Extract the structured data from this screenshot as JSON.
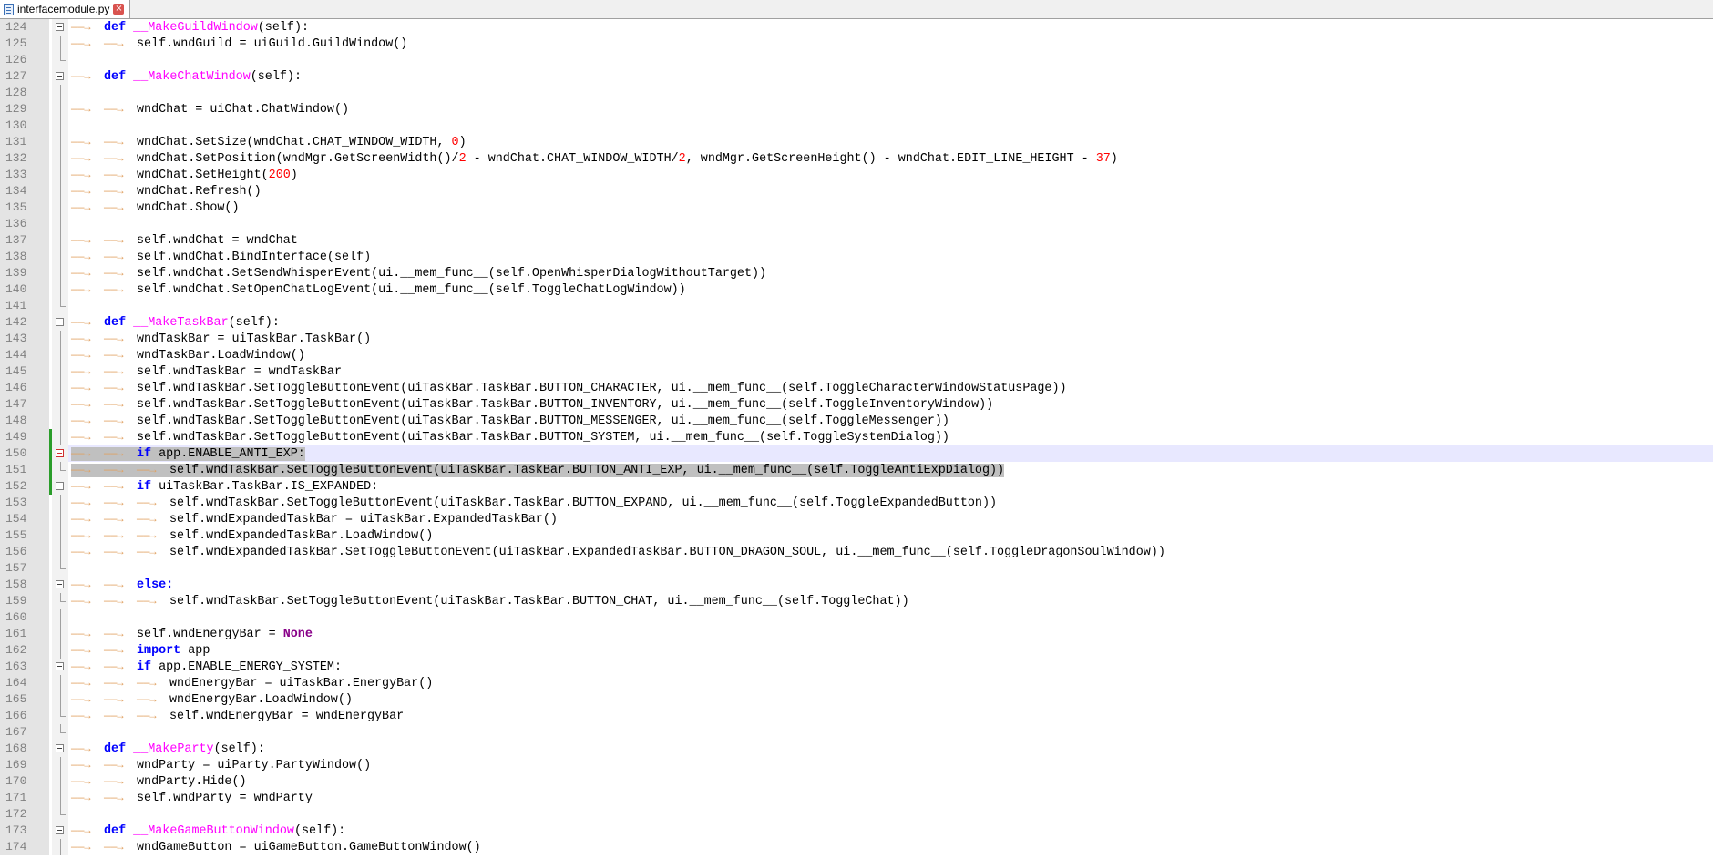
{
  "tab": {
    "filename": "interfacemodule.py",
    "close": "×"
  },
  "lines": [
    {
      "n": "124",
      "ind": 1,
      "fold": "box",
      "segs": [
        {
          "t": "def",
          "c": "kw"
        },
        {
          "t": " "
        },
        {
          "t": "__MakeGuildWindow",
          "c": "fn"
        },
        {
          "t": "(self):"
        }
      ]
    },
    {
      "n": "125",
      "ind": 2,
      "fold": "line",
      "segs": [
        {
          "t": "self.wndGuild = uiGuild.GuildWindow()"
        }
      ]
    },
    {
      "n": "126",
      "ind": 0,
      "fold": "end",
      "segs": []
    },
    {
      "n": "127",
      "ind": 1,
      "fold": "box",
      "segs": [
        {
          "t": "def",
          "c": "kw"
        },
        {
          "t": " "
        },
        {
          "t": "__MakeChatWindow",
          "c": "fn"
        },
        {
          "t": "(self):"
        }
      ]
    },
    {
      "n": "128",
      "ind": 0,
      "fold": "line",
      "segs": []
    },
    {
      "n": "129",
      "ind": 2,
      "fold": "line",
      "segs": [
        {
          "t": "wndChat = uiChat.ChatWindow()"
        }
      ]
    },
    {
      "n": "130",
      "ind": 0,
      "fold": "line",
      "segs": []
    },
    {
      "n": "131",
      "ind": 2,
      "fold": "line",
      "segs": [
        {
          "t": "wndChat.SetSize(wndChat.CHAT_WINDOW_WIDTH, "
        },
        {
          "t": "0",
          "c": "num"
        },
        {
          "t": ")"
        }
      ]
    },
    {
      "n": "132",
      "ind": 2,
      "fold": "line",
      "segs": [
        {
          "t": "wndChat.SetPosition(wndMgr.GetScreenWidth()/"
        },
        {
          "t": "2",
          "c": "num"
        },
        {
          "t": " - wndChat.CHAT_WINDOW_WIDTH/"
        },
        {
          "t": "2",
          "c": "num"
        },
        {
          "t": ", wndMgr.GetScreenHeight() - wndChat.EDIT_LINE_HEIGHT - "
        },
        {
          "t": "37",
          "c": "num"
        },
        {
          "t": ")"
        }
      ]
    },
    {
      "n": "133",
      "ind": 2,
      "fold": "line",
      "segs": [
        {
          "t": "wndChat.SetHeight("
        },
        {
          "t": "200",
          "c": "num"
        },
        {
          "t": ")"
        }
      ]
    },
    {
      "n": "134",
      "ind": 2,
      "fold": "line",
      "segs": [
        {
          "t": "wndChat.Refresh()"
        }
      ]
    },
    {
      "n": "135",
      "ind": 2,
      "fold": "line",
      "segs": [
        {
          "t": "wndChat.Show()"
        }
      ]
    },
    {
      "n": "136",
      "ind": 0,
      "fold": "line",
      "segs": []
    },
    {
      "n": "137",
      "ind": 2,
      "fold": "line",
      "segs": [
        {
          "t": "self.wndChat = wndChat"
        }
      ]
    },
    {
      "n": "138",
      "ind": 2,
      "fold": "line",
      "segs": [
        {
          "t": "self.wndChat.BindInterface(self)"
        }
      ]
    },
    {
      "n": "139",
      "ind": 2,
      "fold": "line",
      "segs": [
        {
          "t": "self.wndChat.SetSendWhisperEvent(ui.__mem_func__(self.OpenWhisperDialogWithoutTarget))"
        }
      ]
    },
    {
      "n": "140",
      "ind": 2,
      "fold": "line",
      "segs": [
        {
          "t": "self.wndChat.SetOpenChatLogEvent(ui.__mem_func__(self.ToggleChatLogWindow))"
        }
      ]
    },
    {
      "n": "141",
      "ind": 0,
      "fold": "end",
      "segs": []
    },
    {
      "n": "142",
      "ind": 1,
      "fold": "box",
      "segs": [
        {
          "t": "def",
          "c": "kw"
        },
        {
          "t": " "
        },
        {
          "t": "__MakeTaskBar",
          "c": "fn"
        },
        {
          "t": "(self):"
        }
      ]
    },
    {
      "n": "143",
      "ind": 2,
      "fold": "line",
      "segs": [
        {
          "t": "wndTaskBar = uiTaskBar.TaskBar()"
        }
      ]
    },
    {
      "n": "144",
      "ind": 2,
      "fold": "line",
      "segs": [
        {
          "t": "wndTaskBar.LoadWindow()"
        }
      ]
    },
    {
      "n": "145",
      "ind": 2,
      "fold": "line",
      "segs": [
        {
          "t": "self.wndTaskBar = wndTaskBar"
        }
      ]
    },
    {
      "n": "146",
      "ind": 2,
      "fold": "line",
      "segs": [
        {
          "t": "self.wndTaskBar.SetToggleButtonEvent(uiTaskBar.TaskBar.BUTTON_CHARACTER, ui.__mem_func__(self.ToggleCharacterWindowStatusPage))"
        }
      ]
    },
    {
      "n": "147",
      "ind": 2,
      "fold": "line",
      "segs": [
        {
          "t": "self.wndTaskBar.SetToggleButtonEvent(uiTaskBar.TaskBar.BUTTON_INVENTORY, ui.__mem_func__(self.ToggleInventoryWindow))"
        }
      ]
    },
    {
      "n": "148",
      "ind": 2,
      "fold": "line",
      "segs": [
        {
          "t": "self.wndTaskBar.SetToggleButtonEvent(uiTaskBar.TaskBar.BUTTON_MESSENGER, ui.__mem_func__(self.ToggleMessenger))"
        }
      ]
    },
    {
      "n": "149",
      "ind": 2,
      "fold": "line",
      "change": true,
      "segs": [
        {
          "t": "self.wndTaskBar.SetToggleButtonEvent(uiTaskBar.TaskBar.BUTTON_SYSTEM, ui.__mem_func__(self.ToggleSystemDialog))"
        }
      ]
    },
    {
      "n": "150",
      "ind": 2,
      "fold": "redbox",
      "change": true,
      "hl": true,
      "sel": true,
      "segs": [
        {
          "t": "if",
          "c": "kw"
        },
        {
          "t": " app.ENABLE_ANTI_EXP:"
        }
      ]
    },
    {
      "n": "151",
      "ind": 3,
      "fold": "end",
      "change": true,
      "sel": true,
      "segs": [
        {
          "t": "self.wndTaskBar.SetToggleButtonEvent(uiTaskBar.TaskBar.BUTTON_ANTI_EXP, ui.__mem_func__(self.ToggleAntiExpDialog))"
        }
      ]
    },
    {
      "n": "152",
      "ind": 2,
      "fold": "box",
      "change": true,
      "segs": [
        {
          "t": "if",
          "c": "kw"
        },
        {
          "t": " uiTaskBar.TaskBar.IS_EXPANDED:"
        }
      ]
    },
    {
      "n": "153",
      "ind": 3,
      "fold": "line",
      "segs": [
        {
          "t": "self.wndTaskBar.SetToggleButtonEvent(uiTaskBar.TaskBar.BUTTON_EXPAND, ui.__mem_func__(self.ToggleExpandedButton))"
        }
      ]
    },
    {
      "n": "154",
      "ind": 3,
      "fold": "line",
      "segs": [
        {
          "t": "self.wndExpandedTaskBar = uiTaskBar.ExpandedTaskBar()"
        }
      ]
    },
    {
      "n": "155",
      "ind": 3,
      "fold": "line",
      "segs": [
        {
          "t": "self.wndExpandedTaskBar.LoadWindow()"
        }
      ]
    },
    {
      "n": "156",
      "ind": 3,
      "fold": "line",
      "segs": [
        {
          "t": "self.wndExpandedTaskBar.SetToggleButtonEvent(uiTaskBar.ExpandedTaskBar.BUTTON_DRAGON_SOUL, ui.__mem_func__(self.ToggleDragonSoulWindow))"
        }
      ]
    },
    {
      "n": "157",
      "ind": 0,
      "fold": "end",
      "segs": []
    },
    {
      "n": "158",
      "ind": 2,
      "fold": "box",
      "segs": [
        {
          "t": "else:",
          "c": "kw"
        }
      ]
    },
    {
      "n": "159",
      "ind": 3,
      "fold": "end",
      "segs": [
        {
          "t": "self.wndTaskBar.SetToggleButtonEvent(uiTaskBar.TaskBar.BUTTON_CHAT, ui.__mem_func__(self.ToggleChat))"
        }
      ]
    },
    {
      "n": "160",
      "ind": 0,
      "fold": "line",
      "segs": []
    },
    {
      "n": "161",
      "ind": 2,
      "fold": "line",
      "segs": [
        {
          "t": "self.wndEnergyBar = "
        },
        {
          "t": "None",
          "c": "none"
        }
      ]
    },
    {
      "n": "162",
      "ind": 2,
      "fold": "line",
      "segs": [
        {
          "t": "import",
          "c": "imp"
        },
        {
          "t": " app"
        }
      ]
    },
    {
      "n": "163",
      "ind": 2,
      "fold": "box",
      "segs": [
        {
          "t": "if",
          "c": "kw"
        },
        {
          "t": " app.ENABLE_ENERGY_SYSTEM:"
        }
      ]
    },
    {
      "n": "164",
      "ind": 3,
      "fold": "line",
      "segs": [
        {
          "t": "wndEnergyBar = uiTaskBar.EnergyBar()"
        }
      ]
    },
    {
      "n": "165",
      "ind": 3,
      "fold": "line",
      "segs": [
        {
          "t": "wndEnergyBar.LoadWindow()"
        }
      ]
    },
    {
      "n": "166",
      "ind": 3,
      "fold": "end",
      "segs": [
        {
          "t": "self.wndEnergyBar = wndEnergyBar"
        }
      ]
    },
    {
      "n": "167",
      "ind": 0,
      "fold": "end",
      "segs": []
    },
    {
      "n": "168",
      "ind": 1,
      "fold": "box",
      "segs": [
        {
          "t": "def",
          "c": "kw"
        },
        {
          "t": " "
        },
        {
          "t": "__MakeParty",
          "c": "fn"
        },
        {
          "t": "(self):"
        }
      ]
    },
    {
      "n": "169",
      "ind": 2,
      "fold": "line",
      "segs": [
        {
          "t": "wndParty = uiParty.PartyWindow()"
        }
      ]
    },
    {
      "n": "170",
      "ind": 2,
      "fold": "line",
      "segs": [
        {
          "t": "wndParty.Hide()"
        }
      ]
    },
    {
      "n": "171",
      "ind": 2,
      "fold": "line",
      "segs": [
        {
          "t": "self.wndParty = wndParty"
        }
      ]
    },
    {
      "n": "172",
      "ind": 0,
      "fold": "end",
      "segs": []
    },
    {
      "n": "173",
      "ind": 1,
      "fold": "box",
      "segs": [
        {
          "t": "def",
          "c": "kw"
        },
        {
          "t": " "
        },
        {
          "t": "__MakeGameButtonWindow",
          "c": "fn"
        },
        {
          "t": "(self):"
        }
      ]
    },
    {
      "n": "174",
      "ind": 2,
      "fold": "line",
      "segs": [
        {
          "t": "wndGameButton = uiGameButton.GameButtonWindow()"
        }
      ]
    }
  ]
}
